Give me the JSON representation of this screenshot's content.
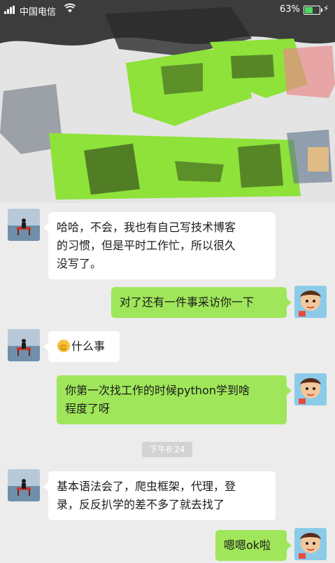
{
  "status_bar": {
    "carrier": "中国电信",
    "battery_percent": "63%",
    "battery_level": 0.63
  },
  "chat": {
    "timestamp": "下午8:24",
    "messages": [
      {
        "side": "left",
        "lines": [
          "哈哈，不会，我也有自己写技术博客",
          "的习惯，但是平时工作忙，所以很久",
          "没写了。"
        ]
      },
      {
        "side": "right",
        "lines": [
          "对了还有一件事采访你一下"
        ]
      },
      {
        "side": "left",
        "emoji": "facepalm-emoji",
        "lines": [
          "什么事"
        ]
      },
      {
        "side": "right",
        "lines": [
          "你第一次找工作的时候python学到啥",
          "程度了呀"
        ]
      },
      {
        "side": "left",
        "lines": [
          "基本语法会了，爬虫框架，代理，登",
          "录，反反扒学的差不多了就去找了"
        ]
      },
      {
        "side": "right",
        "lines": [
          "嗯嗯ok啦"
        ]
      }
    ]
  },
  "colors": {
    "background": "#ececec",
    "sent_bubble": "#9fe65a",
    "received_bubble": "#ffffff"
  }
}
